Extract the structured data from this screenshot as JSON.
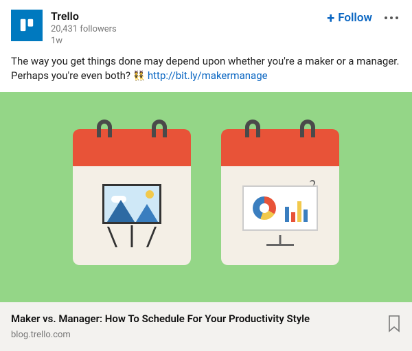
{
  "header": {
    "name": "Trello",
    "followers": "20,431 followers",
    "time": "1w",
    "follow_label": "Follow"
  },
  "post": {
    "text": "The way you get things done may depend upon whether you're a maker or a manager. Perhaps you're even both? ",
    "emoji": "👯",
    "link_label": "http://bit.ly/makermanage"
  },
  "link_preview": {
    "title": "Maker vs. Manager: How To Schedule For Your Productivity Style",
    "domain": "blog.trello.com"
  },
  "colors": {
    "brand": "#0079bf",
    "accent": "#0a66c2",
    "image_bg": "#94d687"
  }
}
